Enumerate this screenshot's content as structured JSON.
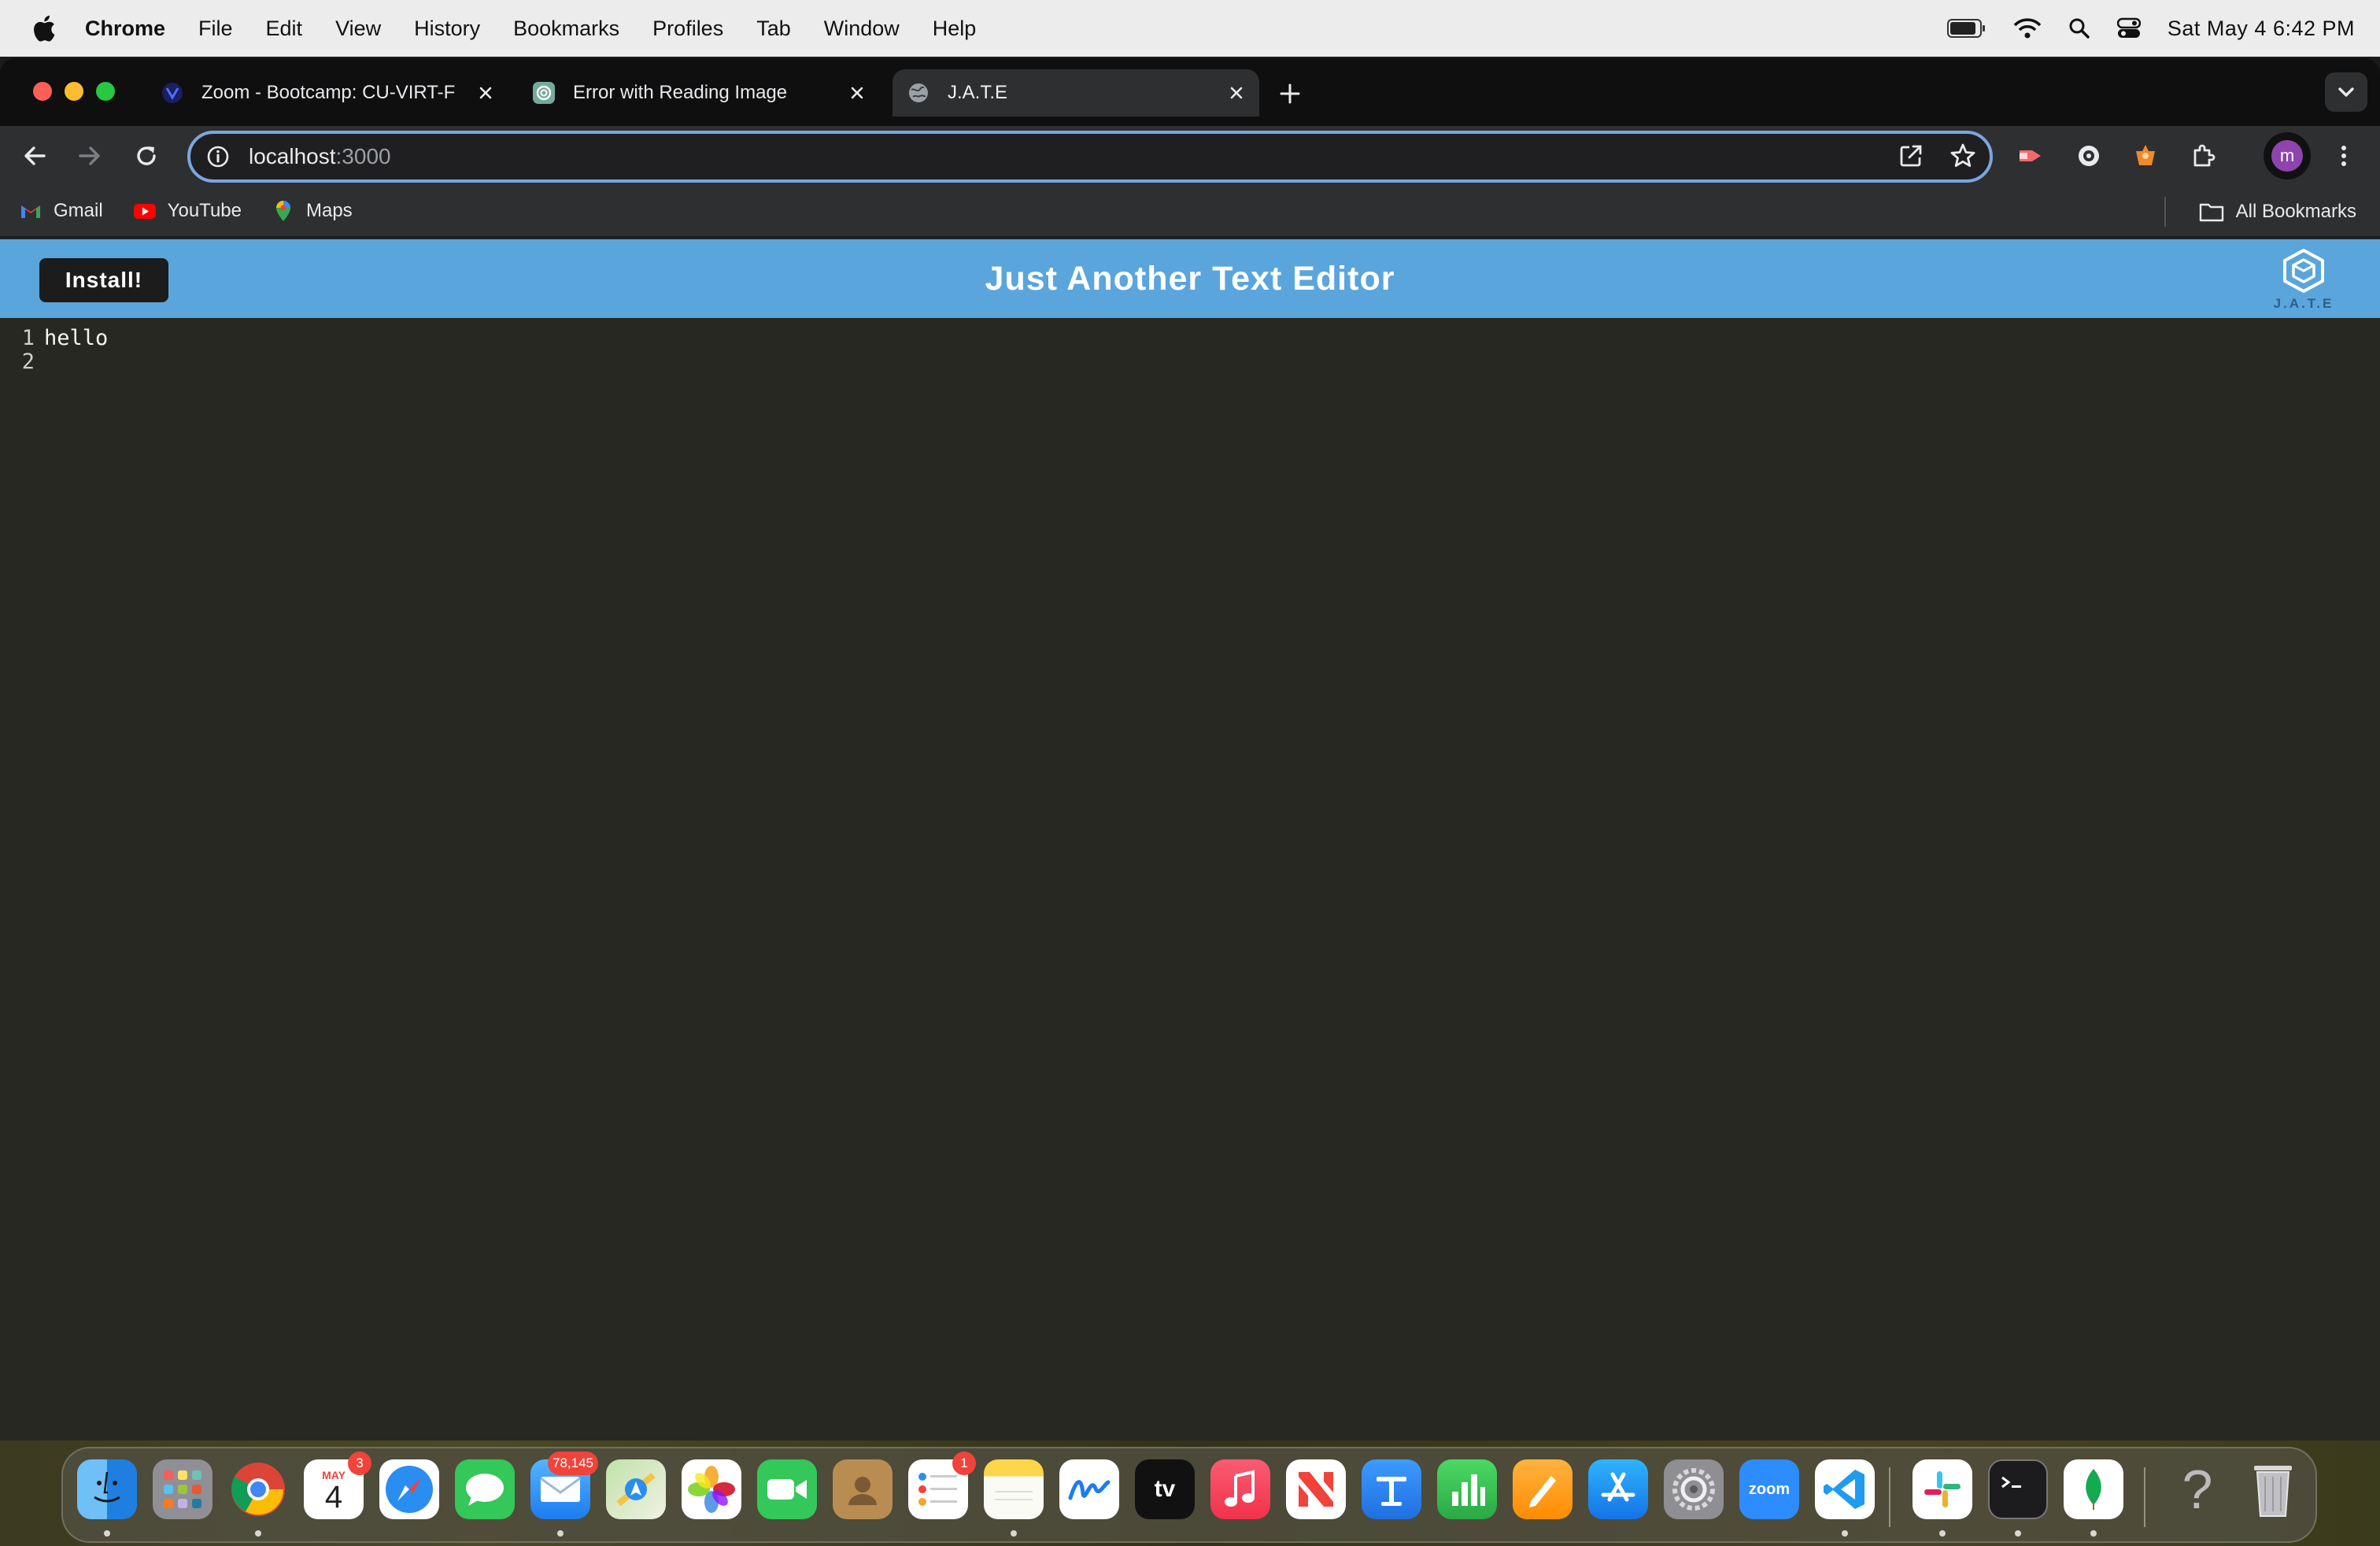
{
  "menubar": {
    "app": "Chrome",
    "items": [
      "File",
      "Edit",
      "View",
      "History",
      "Bookmarks",
      "Profiles",
      "Tab",
      "Window",
      "Help"
    ],
    "clock": "Sat May 4  6:42 PM"
  },
  "tabs": [
    {
      "title": "Zoom - Bootcamp: CU-VIRT-F",
      "favicon": "zoom-icon",
      "active": false
    },
    {
      "title": "Error with Reading Image",
      "favicon": "chatgpt-icon",
      "active": false
    },
    {
      "title": "J.A.T.E",
      "favicon": "globe-icon",
      "active": true
    }
  ],
  "omnibox": {
    "host": "localhost",
    "port": ":3000"
  },
  "bookmarks": {
    "items": [
      {
        "label": "Gmail",
        "icon": "gmail-icon"
      },
      {
        "label": "YouTube",
        "icon": "youtube-icon"
      },
      {
        "label": "Maps",
        "icon": "maps-icon"
      }
    ],
    "all_label": "All Bookmarks"
  },
  "app": {
    "install_label": "Install!",
    "title": "Just Another Text Editor",
    "logo_text": "J.A.T.E",
    "header_color": "#5aa5dc",
    "editor_bg": "#272822"
  },
  "editor": {
    "lines": [
      {
        "number": "1",
        "text": "hello"
      },
      {
        "number": "2",
        "text": ""
      }
    ]
  },
  "dock": {
    "calendar": {
      "month": "MAY",
      "day": "4",
      "badge": "3"
    },
    "mail_badge": "78,145",
    "reminders_badge": "1",
    "zoom_label": "zoom",
    "tv_label": "tv"
  }
}
